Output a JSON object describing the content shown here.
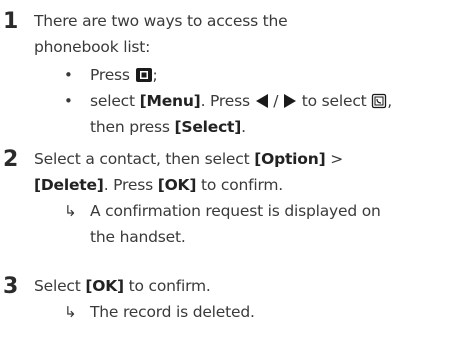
{
  "steps": [
    {
      "number": "1",
      "text_line1": "There are two ways to access the",
      "text_line2": "phonebook list:",
      "bullets": [
        {
          "press": "Press",
          "after_icon": ";"
        },
        {
          "select": "select",
          "menu": "[Menu]",
          "press": ". Press",
          "slash": "/",
          "to_select": "to select",
          "comma": ",",
          "line2_then": "then press",
          "select_btn": "[Select]",
          "period": "."
        }
      ]
    },
    {
      "number": "2",
      "line1_a": "Select a contact, then select",
      "option": "[Option]",
      "gt": ">",
      "delete": "[Delete]",
      "press": ". Press",
      "ok": "[OK]",
      "to_confirm": "to confirm.",
      "result_line1": "A confirmation request is displayed on",
      "result_line2": "the handset."
    },
    {
      "number": "3",
      "select": "Select",
      "ok": "[OK]",
      "to_confirm": "to confirm.",
      "result": "The record is deleted."
    }
  ],
  "icons": {
    "phonebook_key": "phonebook-key-icon",
    "left": "left-triangle-icon",
    "right": "right-triangle-icon",
    "phonebook_menu": "phonebook-menu-icon",
    "result_arrow": "result-arrow"
  },
  "result_arrow_glyph": "↳"
}
